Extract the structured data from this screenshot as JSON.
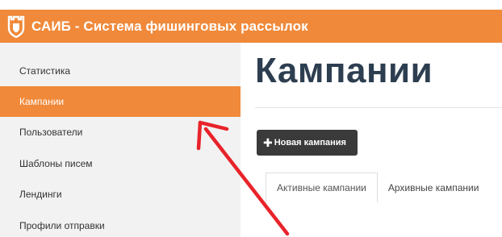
{
  "header": {
    "title": "САИБ - Система фишинговых рассылок",
    "logo_icon": "shield-icon",
    "color": "#f0893a"
  },
  "sidebar": {
    "items": [
      {
        "label": "Статистика",
        "active": false
      },
      {
        "label": "Кампании",
        "active": true
      },
      {
        "label": "Пользователи",
        "active": false
      },
      {
        "label": "Шаблоны писем",
        "active": false
      },
      {
        "label": "Лендинги",
        "active": false
      },
      {
        "label": "Профили отправки",
        "active": false
      }
    ]
  },
  "main": {
    "page_title": "Кампании",
    "new_button_label": "Новая кампания",
    "new_button_icon": "plus-icon",
    "tabs": [
      {
        "label": "Активные кампании",
        "active": true
      },
      {
        "label": "Архивные кампании",
        "active": false
      }
    ]
  },
  "annotation": {
    "arrow_color": "#e8232a"
  }
}
